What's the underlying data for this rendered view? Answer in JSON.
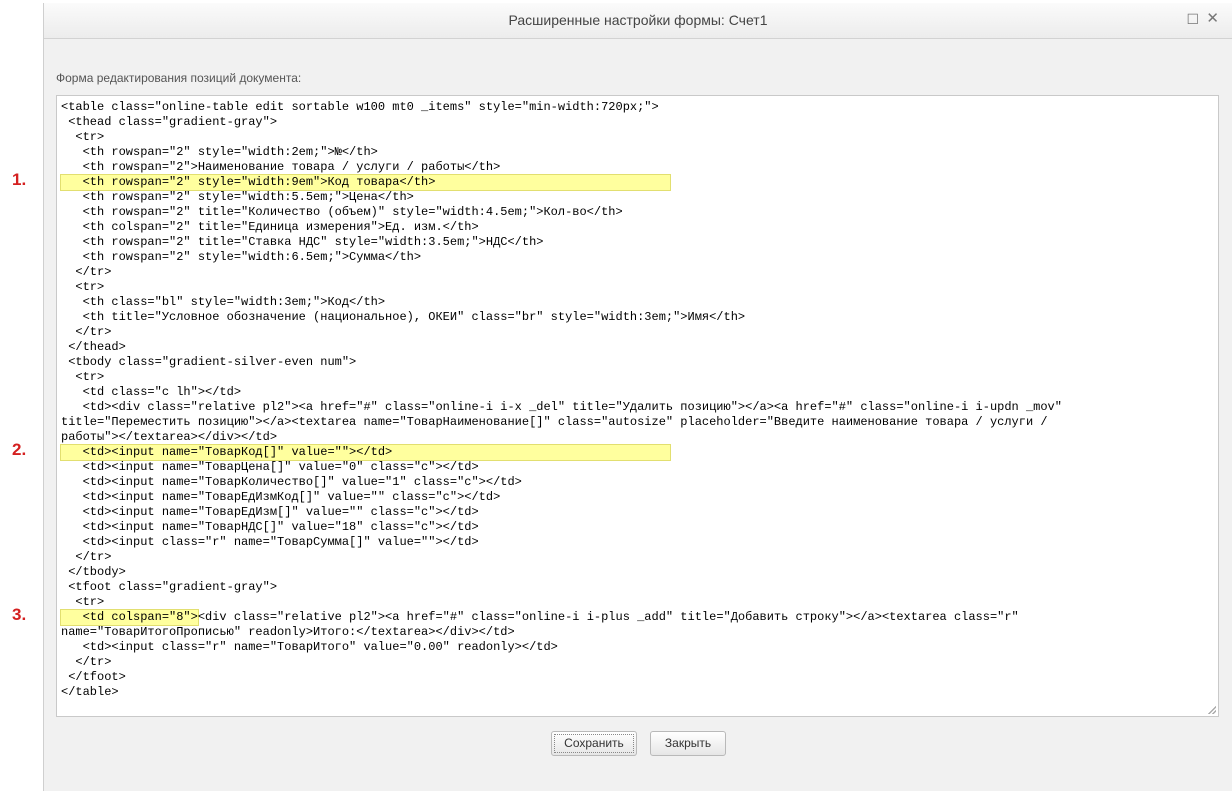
{
  "dialog": {
    "title": "Расширенные настройки формы: Счет1",
    "maximize_glyph": "☐",
    "close_glyph": "✕",
    "form_label": "Форма редактирования позиций документа:",
    "save_label": "Сохранить",
    "close_label": "Закрыть"
  },
  "markers": [
    "1.",
    "2.",
    "3."
  ],
  "code_lines": [
    "<table class=\"online-table edit sortable w100 mt0 _items\" style=\"min-width:720px;\">",
    " <thead class=\"gradient-gray\">",
    "  <tr>",
    "   <th rowspan=\"2\" style=\"width:2em;\">№</th>",
    "   <th rowspan=\"2\">Наименование товара / услуги / работы</th>",
    "   <th rowspan=\"2\" style=\"width:9em\">Код товара</th>",
    "   <th rowspan=\"2\" style=\"width:5.5em;\">Цена</th>",
    "   <th rowspan=\"2\" title=\"Количество (объем)\" style=\"width:4.5em;\">Кол-во</th>",
    "   <th colspan=\"2\" title=\"Единица измерения\">Ед. изм.</th>",
    "   <th rowspan=\"2\" title=\"Ставка НДС\" style=\"width:3.5em;\">НДС</th>",
    "   <th rowspan=\"2\" style=\"width:6.5em;\">Сумма</th>",
    "  </tr>",
    "  <tr>",
    "   <th class=\"bl\" style=\"width:3em;\">Код</th>",
    "   <th title=\"Условное обозначение (национальное), ОКЕИ\" class=\"br\" style=\"width:3em;\">Имя</th>",
    "  </tr>",
    " </thead>",
    " <tbody class=\"gradient-silver-even num\">",
    "  <tr>",
    "   <td class=\"c lh\"></td>",
    "   <td><div class=\"relative pl2\"><a href=\"#\" class=\"online-i i-x _del\" title=\"Удалить позицию\"></a><a href=\"#\" class=\"online-i i-updn _mov\"",
    "title=\"Переместить позицию\"></a><textarea name=\"ТоварНаименование[]\" class=\"autosize\" placeholder=\"Введите наименование товара / услуги /",
    "работы\"></textarea></div></td>",
    "   <td><input name=\"ТоварКод[]\" value=\"\"></td>",
    "   <td><input name=\"ТоварЦена[]\" value=\"0\" class=\"c\"></td>",
    "   <td><input name=\"ТоварКоличество[]\" value=\"1\" class=\"c\"></td>",
    "   <td><input name=\"ТоварЕдИзмКод[]\" value=\"\" class=\"c\"></td>",
    "   <td><input name=\"ТоварЕдИзм[]\" value=\"\" class=\"c\"></td>",
    "   <td><input name=\"ТоварНДС[]\" value=\"18\" class=\"c\"></td>",
    "   <td><input class=\"r\" name=\"ТоварСумма[]\" value=\"\"></td>",
    "  </tr>",
    " </tbody>",
    " <tfoot class=\"gradient-gray\">",
    "  <tr>",
    "   <td colspan=\"8\">",
    "<div class=\"relative pl2\"><a href=\"#\" class=\"online-i i-plus _add\" title=\"Добавить строку\"></a><textarea class=\"r\"",
    "name=\"ТоварИтогоПрописью\" readonly>Итого:</textarea></div></td>",
    "   <td><input class=\"r\" name=\"ТоварИтого\" value=\"0.00\" readonly></td>",
    "  </tr>",
    " </tfoot>",
    "</table>"
  ]
}
